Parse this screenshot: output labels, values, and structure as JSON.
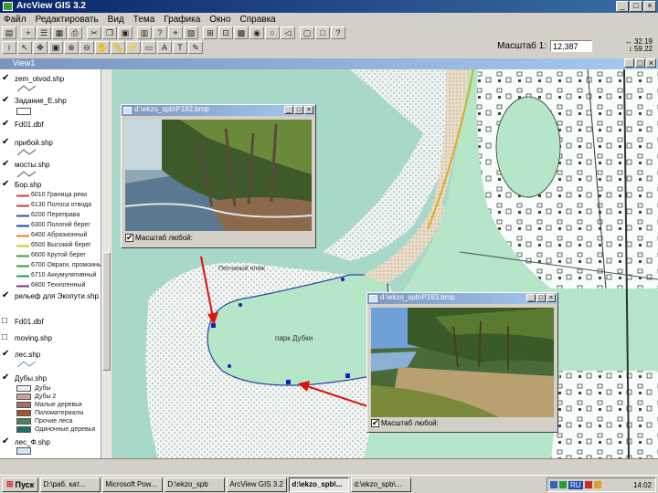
{
  "app": {
    "title": "ArcView GIS 3.2"
  },
  "menu": [
    "Файл",
    "Редактировать",
    "Вид",
    "Тема",
    "Графика",
    "Окно",
    "Справка"
  ],
  "scale": {
    "label": "Масштаб 1:",
    "value": "12,387"
  },
  "coords": {
    "x": "32.19",
    "y": "59.22"
  },
  "view": {
    "title": "View1"
  },
  "toc": {
    "layers": [
      {
        "name": "zem_otvod.shp",
        "checked": true,
        "swatch": ""
      },
      {
        "name": "Задание_Е.shp",
        "checked": true,
        "swatch": "#ffffff"
      },
      {
        "name": "Fd01.dbf",
        "checked": true,
        "swatch": ""
      },
      {
        "name": "прибой.shp",
        "checked": true,
        "swatch": ""
      },
      {
        "name": "мосты.shp",
        "checked": true,
        "swatch": ""
      },
      {
        "name": "Бор.shp",
        "checked": true,
        "swatch": ""
      },
      {
        "name": "рельеф для Экопути.shp",
        "checked": true,
        "swatch": ""
      },
      {
        "name": "Fd01.dbf",
        "checked": false,
        "swatch": ""
      },
      {
        "name": "moving.shp",
        "checked": false,
        "swatch": ""
      },
      {
        "name": "лес.shp",
        "checked": true,
        "swatch": ""
      },
      {
        "name": "Дубы.shp",
        "checked": true,
        "swatch": ""
      },
      {
        "name": "лес_Ф.shp",
        "checked": true,
        "swatch": "#cfe8f8"
      }
    ],
    "bor_legend": [
      {
        "label": "6010 Граница реки",
        "color": "#d04040"
      },
      {
        "label": "6130 Полоса отвода",
        "color": "#c04040"
      },
      {
        "label": "6200 Переправа",
        "color": "#3050a0"
      },
      {
        "label": "6300 Пологий берег",
        "color": "#2040c0"
      },
      {
        "label": "6400 Абразионный",
        "color": "#e08020"
      },
      {
        "label": "6500 Высокий берег",
        "color": "#d0c030"
      },
      {
        "label": "6600 Крутой берег",
        "color": "#40a040"
      },
      {
        "label": "6700 Овраги, промоины",
        "color": "#30a030"
      },
      {
        "label": "6710 Аккумулятивный",
        "color": "#20a050"
      },
      {
        "label": "6800 Техногенный",
        "color": "#803080"
      }
    ],
    "dub_legend": [
      {
        "label": "Дубы",
        "color": "#f0f0f0"
      },
      {
        "label": "Дубы 2",
        "color": "#c8a0a0"
      },
      {
        "label": "Малые деревья",
        "color": "#a07070"
      },
      {
        "label": "Пиломатериалы",
        "color": "#a0582a"
      },
      {
        "label": "Прочие леса",
        "color": "#508060"
      },
      {
        "label": "Одиночные деревья",
        "color": "#20706a"
      }
    ]
  },
  "map": {
    "labels": {
      "beach": "Песчаный пляж",
      "park": "парк Дубки"
    }
  },
  "photo1": {
    "title": "d:\\ekzo_spb\\P192.bmp",
    "scale_label": "Масштаб любой:"
  },
  "photo2": {
    "title": "d:\\ekzo_spb\\P193.bmp",
    "scale_label": "Масштаб любой:"
  },
  "taskbar": {
    "start": "Пуск",
    "tasks": [
      "D:\\раб. кат...",
      "Microsoft Pow...",
      "D:\\ekzo_spb",
      "ArcView GIS 3.2",
      "d:\\ekzo_spb\\...",
      "d:\\ekzo_spb\\..."
    ],
    "lang": "RU",
    "clock": "14:02"
  }
}
